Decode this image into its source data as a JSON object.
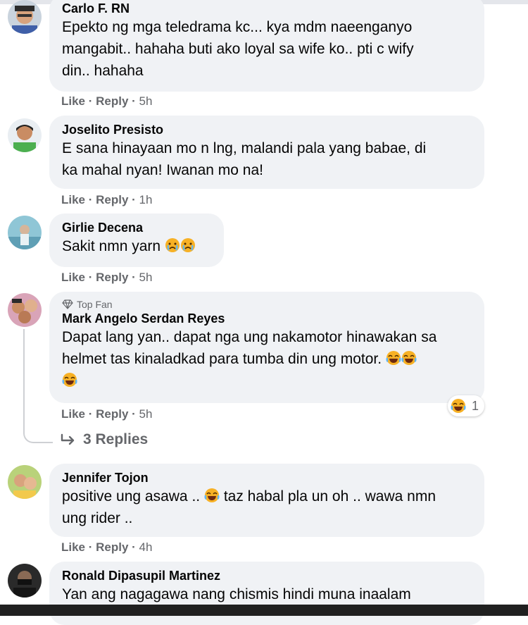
{
  "comments": [
    {
      "author": "Carlo F. RN",
      "lines": [
        "Epekto ng mga teledrama kc... kya mdm naeenganyo",
        "mangabit.. hahaha buti ako loyal sa wife ko.. pti c wify",
        "din.. hahaha"
      ],
      "like": "Like",
      "reply": "Reply",
      "time": "5h"
    },
    {
      "author": "Joselito Presisto",
      "lines": [
        "E sana hinayaan mo n lng, malandi pala yang babae, di",
        "ka mahal nyan! Iwanan mo na!"
      ],
      "like": "Like",
      "reply": "Reply",
      "time": "1h"
    },
    {
      "author": "Girlie Decena",
      "lines": [
        "Sakit nmn yarn"
      ],
      "like": "Like",
      "reply": "Reply",
      "time": "5h"
    },
    {
      "badge": "Top Fan",
      "author": "Mark Angelo Serdan Reyes",
      "lines": [
        "Dapat lang yan.. dapat nga ung nakamotor hinawakan sa",
        "helmet tas kinaladkad para tumba din ung motor."
      ],
      "like": "Like",
      "reply": "Reply",
      "time": "5h",
      "reaction_count": "1",
      "replies_label": "3 Replies"
    },
    {
      "author": "Jennifer Tojon",
      "line1_before": "positive ung asawa ..",
      "line1_after": "taz habal pla un oh .. wawa nmn",
      "line2": "ung rider ..",
      "like": "Like",
      "reply": "Reply",
      "time": "4h"
    },
    {
      "author": "Ronald Dipasupil Martinez",
      "lines": [
        "Yan ang nagagawa nang chismis hindi muna inaalam"
      ]
    }
  ],
  "icons": {
    "laugh_cry": "laughing-crying-emoji",
    "sad_cry": "crying-emoji",
    "diamond": "top-fan-diamond-icon",
    "reply_arrow": "reply-arrow-icon"
  },
  "colors": {
    "bubble": "#f0f2f5",
    "meta": "#65676b",
    "text": "#050505",
    "emoji": "#f7b125"
  }
}
